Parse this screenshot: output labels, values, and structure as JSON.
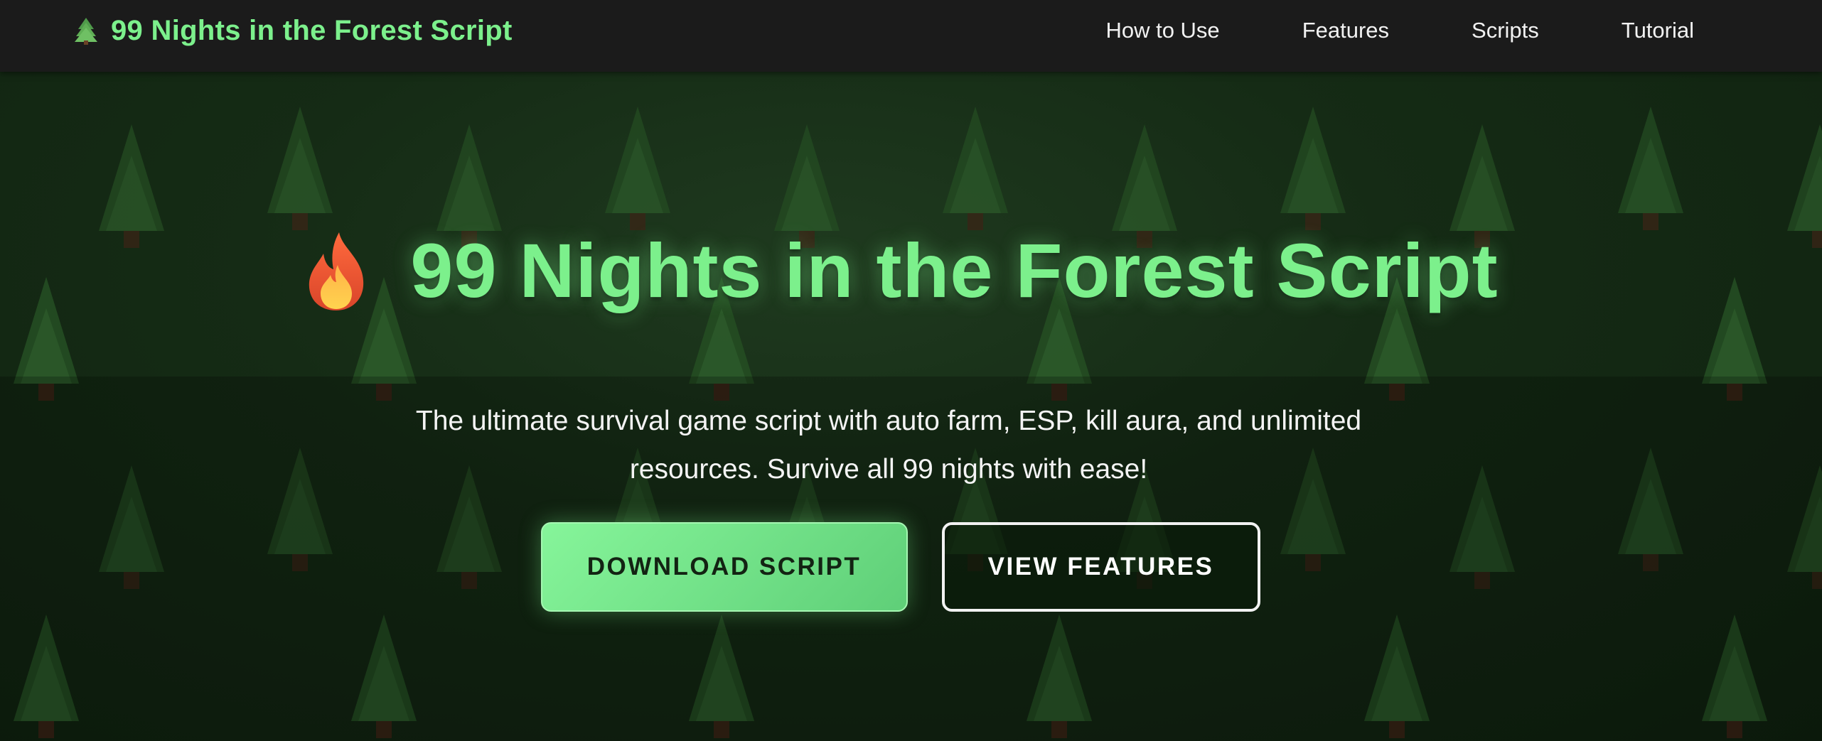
{
  "colors": {
    "accent": "#7cf08c",
    "navbar_bg": "#1b1b1b",
    "page_bg": "#152b15",
    "tree": "#2c5a2a",
    "trunk": "#3a2416"
  },
  "navbar": {
    "brand_icon": "tree-icon",
    "brand_text": "99 Nights in the Forest Script",
    "links": [
      "How to Use",
      "Features",
      "Scripts",
      "Tutorial"
    ]
  },
  "hero": {
    "icon": "fire-icon",
    "title": "99 Nights in the Forest Script",
    "subtitle": "The ultimate survival game script with auto farm, ESP, kill aura, and unlimited resources. Survive all 99 nights with ease!",
    "primary_button": "DOWNLOAD SCRIPT",
    "secondary_button": "VIEW FEATURES"
  }
}
